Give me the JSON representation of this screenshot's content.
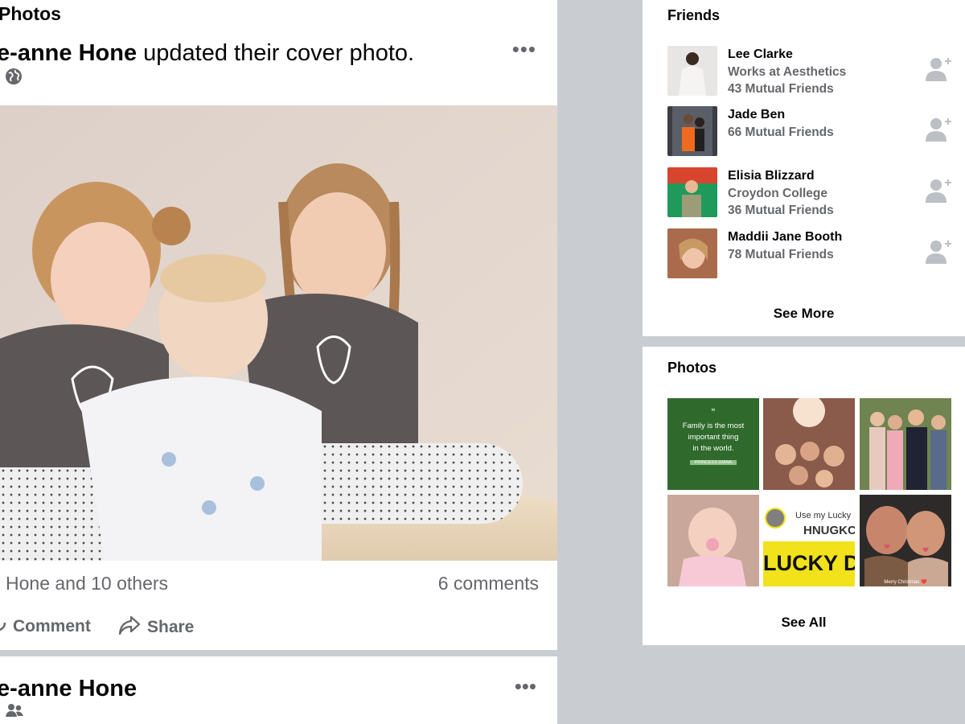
{
  "feed": {
    "section_title": "Photos",
    "post1": {
      "author": "ie-anne Hone",
      "action_text": " updated their cover photo.",
      "meta_dot": "·",
      "reactions_text": "Hone and 10 others",
      "comments_text": "6 comments",
      "comment_label": "Comment",
      "share_label": "Share",
      "more_glyph": "•••"
    },
    "post2": {
      "author": "ie-anne Hone",
      "meta_dot": "·",
      "more_glyph": "•••"
    }
  },
  "friends": {
    "title": "Friends",
    "items": [
      {
        "name": "Lee Clarke",
        "line1": "Works at Aesthetics",
        "line2": "43 Mutual Friends"
      },
      {
        "name": "Jade Ben",
        "line1": "66 Mutual Friends",
        "line2": ""
      },
      {
        "name": "Elisia Blizzard",
        "line1": "Croydon College",
        "line2": "36 Mutual Friends"
      },
      {
        "name": "Maddii Jane Booth",
        "line1": "78 Mutual Friends",
        "line2": ""
      }
    ],
    "see_more": "See More"
  },
  "photos": {
    "title": "Photos",
    "tile1_lines": [
      "“",
      "Family is the most",
      "important thing",
      "in the world."
    ],
    "tile1_badge": "PRINCESS DIANA",
    "tile5_line1": "Use my Lucky",
    "tile5_line2": "HNUGKC",
    "tile5_line3": "LUCKY D",
    "tile6_caption": "Merry Christmas ❤️",
    "see_all": "See All"
  },
  "icons": {
    "globe": "globe-icon",
    "group": "group-icon",
    "comment": "comment-icon",
    "share": "share-icon",
    "add_friend": "add-friend-icon"
  },
  "colors": {
    "page_bg": "#c9ccd1",
    "card_bg": "#ffffff",
    "secondary_text": "#65676b",
    "tile1_green": "#2f6a2c",
    "tile5_yellow": "#f2e21c"
  }
}
